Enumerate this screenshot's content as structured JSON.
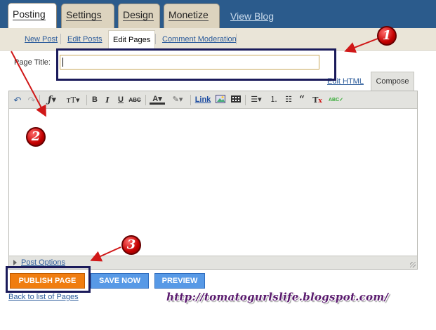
{
  "top_tabs": [
    "Posting",
    "Settings",
    "Design",
    "Monetize"
  ],
  "view_blog": "View Blog",
  "sub_tabs": [
    "New Post",
    "Edit Posts",
    "Edit Pages",
    "Comment Moderation"
  ],
  "page_title": {
    "label": "Page Title:",
    "value": ""
  },
  "editor_modes": {
    "html": "Edit HTML",
    "compose": "Compose"
  },
  "toolbar": {
    "link": "Link"
  },
  "post_options": "Post Options",
  "buttons": {
    "publish": "PUBLISH PAGE",
    "save": "SAVE NOW",
    "preview": "PREVIEW"
  },
  "back_link": "Back to list of Pages",
  "watermark": "http://tomatogurlslife.blogspot.com/",
  "annotations": {
    "one": "1",
    "two": "2",
    "three": "3"
  },
  "colors": {
    "top_bar": "#2b5b8c",
    "publish": "#f07d10",
    "secondary": "#5799e6",
    "annotation_box": "#1a1a5a",
    "arrow": "#d01818"
  }
}
